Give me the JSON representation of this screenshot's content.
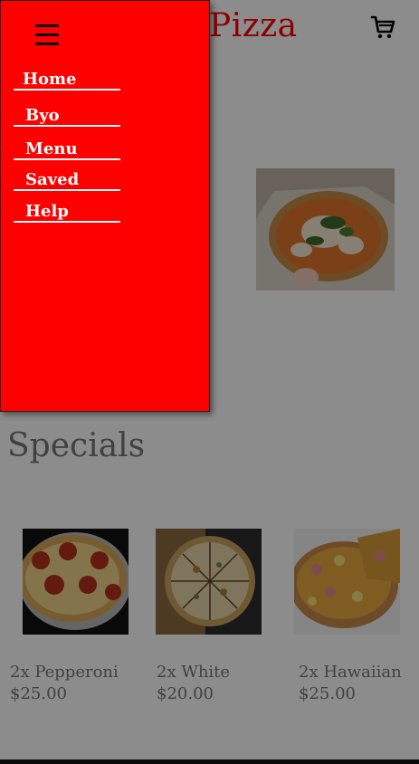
{
  "header": {
    "brand_text": "Pizza",
    "cart_icon": "cart-icon"
  },
  "hero": {
    "title_visible_fragment": "izza"
  },
  "specials": {
    "title": "Specials",
    "items": [
      {
        "name": "2x Pepperoni",
        "price": "$25.00"
      },
      {
        "name": "2x White",
        "price": "$20.00"
      },
      {
        "name": "2x Hawaiian",
        "price": "$25.00"
      }
    ]
  },
  "drawer": {
    "menu_icon": "hamburger-icon",
    "items": [
      {
        "label": "Home"
      },
      {
        "label": "Byo"
      },
      {
        "label": "Menu"
      },
      {
        "label": "Saved"
      },
      {
        "label": "Help"
      }
    ]
  },
  "colors": {
    "brand_red": "#ff0000",
    "drawer_background": "#ff0000",
    "overlay": "rgba(0,0,0,0.45)"
  }
}
